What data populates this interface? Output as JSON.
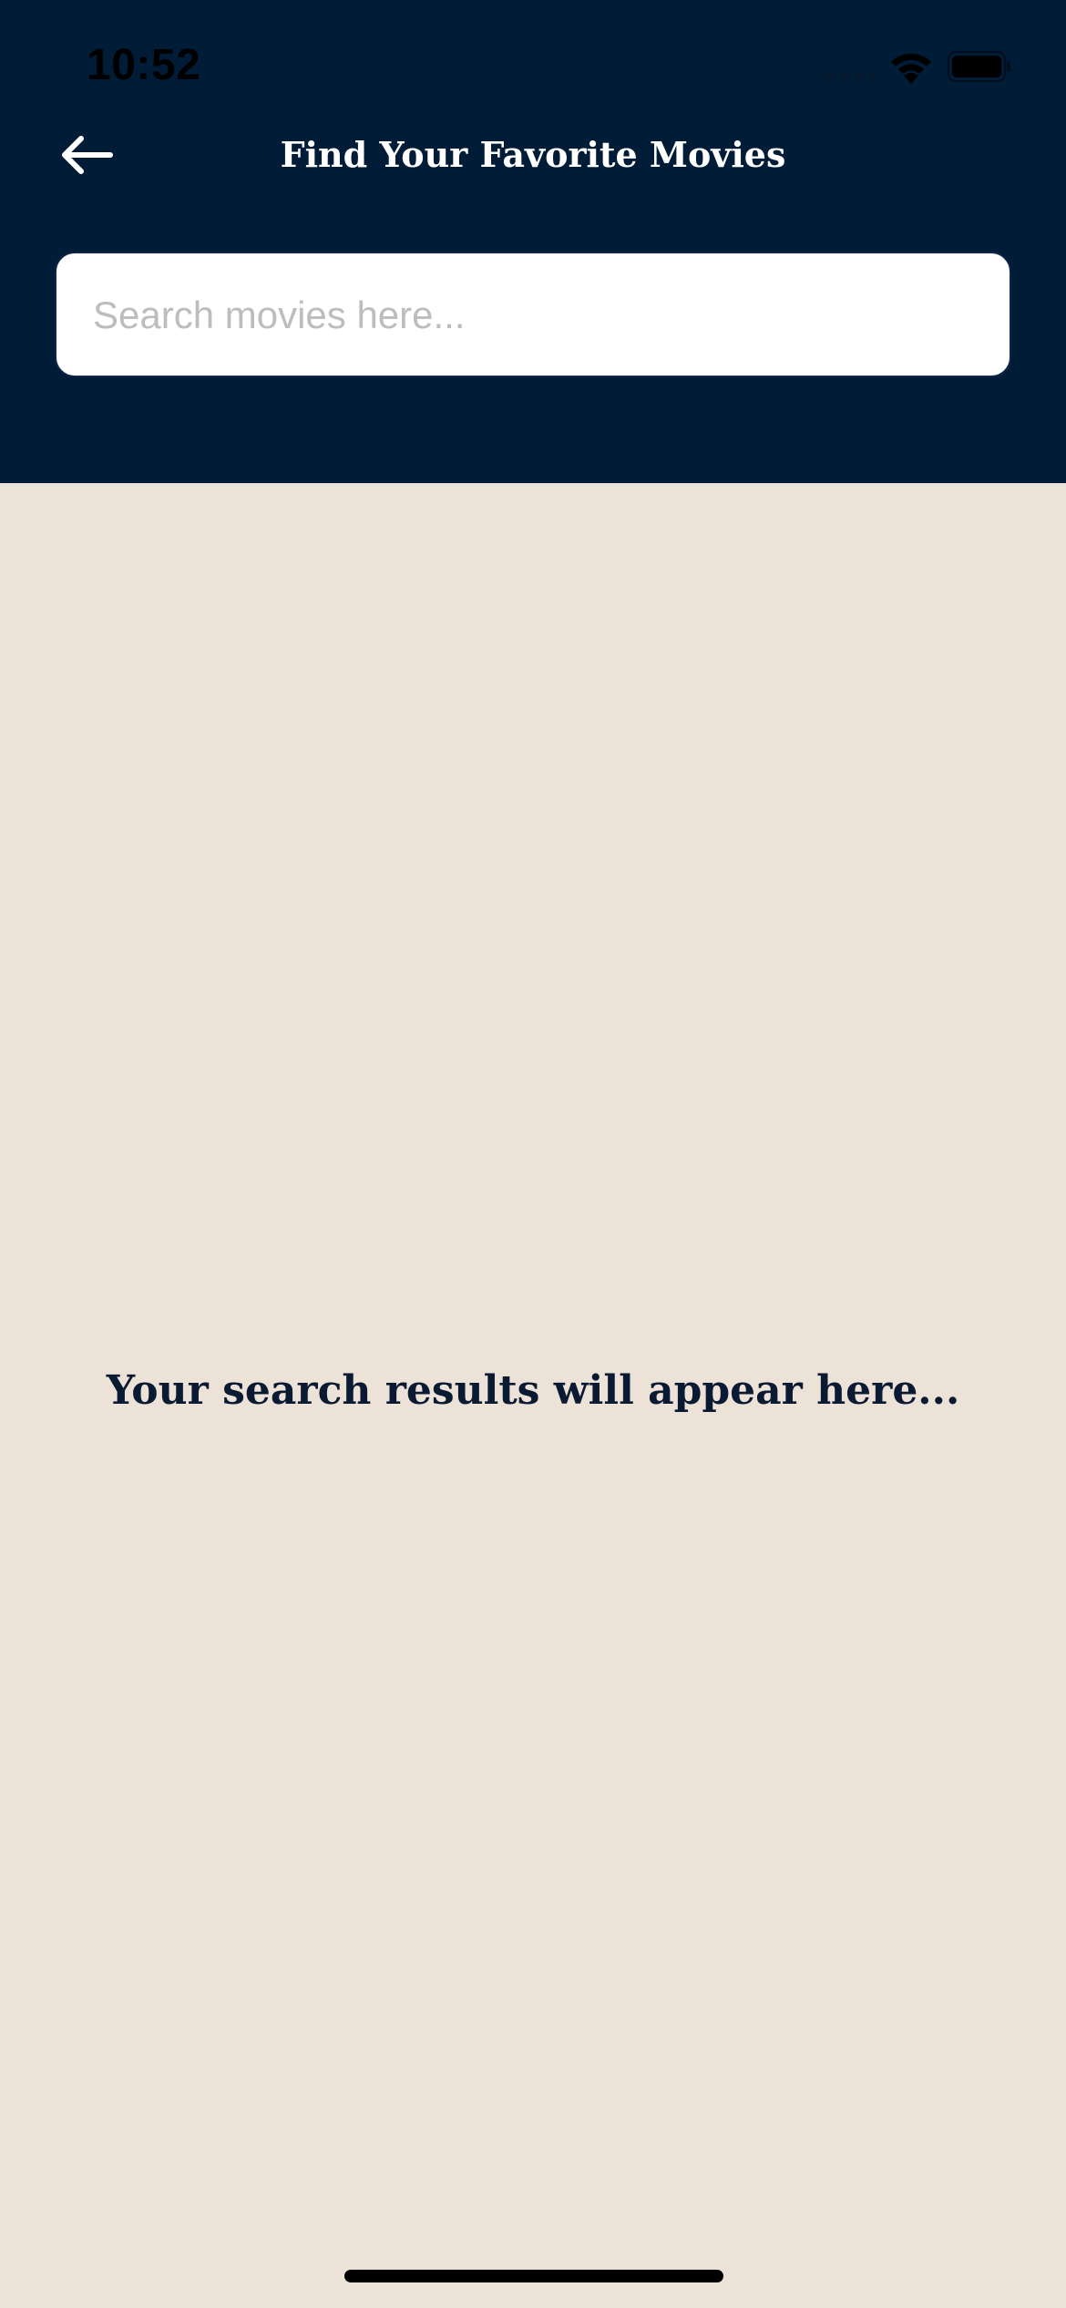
{
  "status_bar": {
    "time": "10:52"
  },
  "header": {
    "title": "Find Your Favorite Movies",
    "back_icon": "arrow-left-icon"
  },
  "search": {
    "placeholder": "Search movies here...",
    "value": ""
  },
  "results": {
    "empty_message": "Your search results will appear here..."
  },
  "colors": {
    "header_bg": "#011C37",
    "body_bg": "#EDE2D8",
    "message_text": "#0B1A33"
  }
}
